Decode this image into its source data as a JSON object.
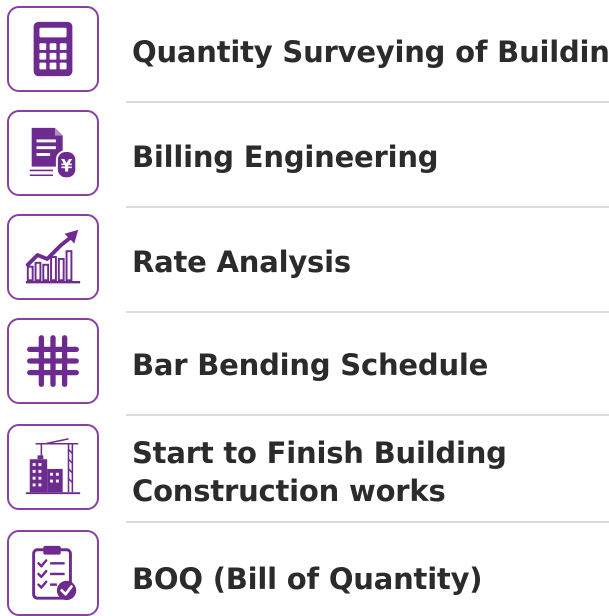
{
  "colors": {
    "accent": "#6e2b8f",
    "border": "#8a3fa6",
    "text": "#2b2b2b",
    "divider": "#dcdcdc"
  },
  "items": [
    {
      "label": "Quantity Surveying of Building",
      "icon": "calculator-icon"
    },
    {
      "label": "Billing Engineering",
      "icon": "invoice-yen-icon"
    },
    {
      "label": "Rate Analysis",
      "icon": "growth-chart-icon"
    },
    {
      "label": "Bar Bending Schedule",
      "icon": "rebar-grid-icon"
    },
    {
      "label_line1": "Start to Finish Building",
      "label_line2": "Construction works",
      "icon": "building-crane-icon"
    },
    {
      "label": "BOQ (Bill of Quantity)",
      "icon": "clipboard-checklist-icon"
    }
  ]
}
